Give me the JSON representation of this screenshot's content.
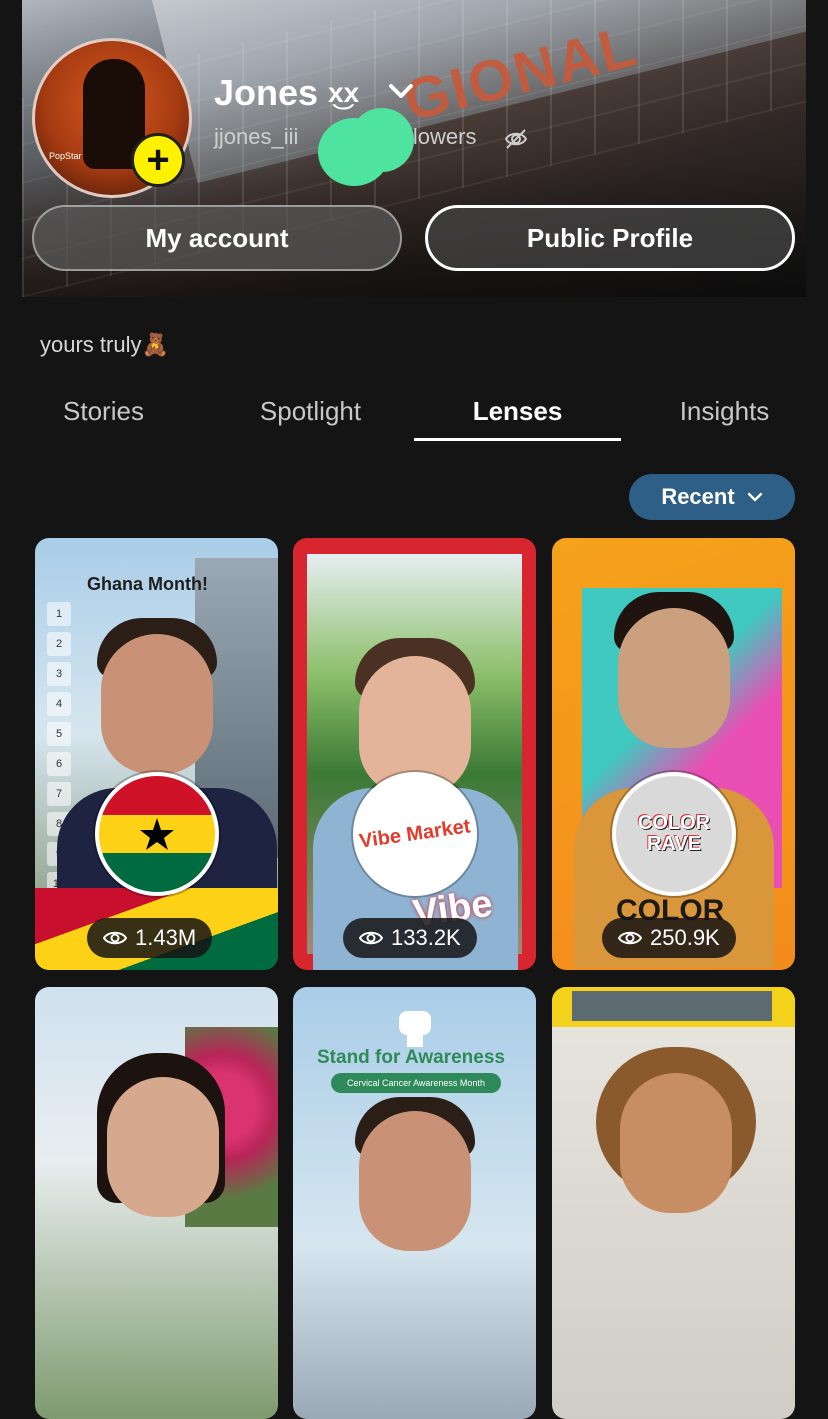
{
  "profile": {
    "display_name": "Jones",
    "name_deco": "x͜x",
    "username": "jjones_iii",
    "followers_suffix": "llowers",
    "avatar_caption": "PopStar",
    "add_symbol": "+"
  },
  "header_background_sign": "GIONAL",
  "buttons": {
    "my_account": "My account",
    "public_profile": "Public Profile"
  },
  "bio": "yours truly",
  "bio_emoji": "🧸",
  "tabs": [
    {
      "label": "Stories",
      "active": false
    },
    {
      "label": "Spotlight",
      "active": false
    },
    {
      "label": "Lenses",
      "active": true
    },
    {
      "label": "Insights",
      "active": false
    }
  ],
  "sort": {
    "label": "Recent"
  },
  "lenses": [
    {
      "views": "1.43M",
      "badge": "ghana-flag",
      "overlay": "Ghana Month!"
    },
    {
      "views": "133.2K",
      "badge": "vibe-market-logo",
      "logo_text": "Vibe Market",
      "overlay": "Vibe"
    },
    {
      "views": "250.9K",
      "badge": "color-rave-logo",
      "logo_text": "COLOR RAVE",
      "overlay": "COLOR"
    },
    {
      "views": null,
      "overlay": ""
    },
    {
      "views": null,
      "overlay": "Stand for Awareness",
      "subtitle": "Cervical Cancer Awareness Month"
    },
    {
      "views": null,
      "overlay": ""
    }
  ],
  "colors": {
    "add_button": "#fff200",
    "sort_pill": "#2e5f86",
    "redaction": "#4fe3a0"
  }
}
